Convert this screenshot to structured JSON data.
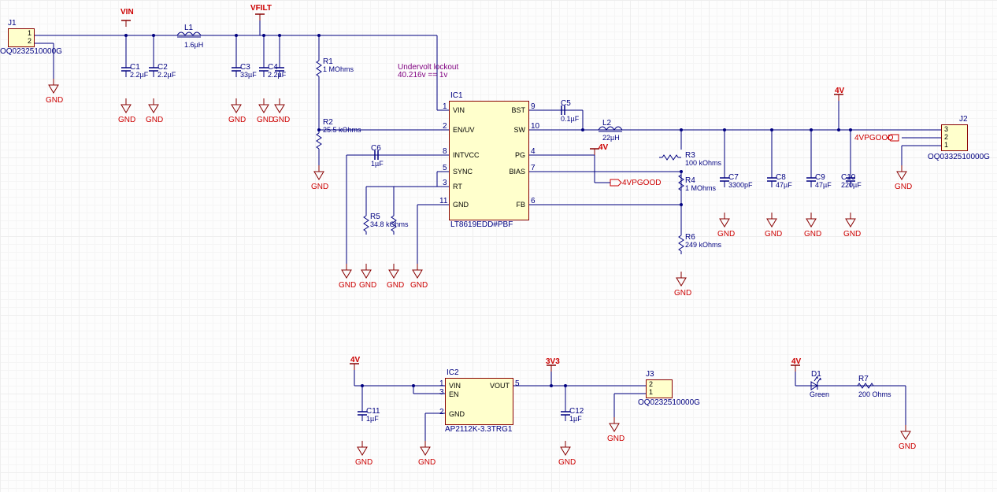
{
  "nets": {
    "vin": "VIN",
    "vfilt": "VFILT",
    "gnd": "GND",
    "4v": "4V",
    "3v3": "3V3",
    "4vpgood": "4VPGOOD"
  },
  "annotation": {
    "line1": "Undervolt lockout",
    "line2": "40.216v == 1v"
  },
  "J1": {
    "ref": "J1",
    "pn": "OQ0232510000G",
    "p1": "1",
    "p2": "2"
  },
  "J2": {
    "ref": "J2",
    "pn": "OQ0332510000G",
    "p1": "1",
    "p2": "2",
    "p3": "3"
  },
  "J3": {
    "ref": "J3",
    "pn": "OQ0232510000G",
    "p1": "1",
    "p2": "2"
  },
  "C1": {
    "ref": "C1",
    "val": "2.2µF"
  },
  "C2": {
    "ref": "C2",
    "val": "2.2µF"
  },
  "C3": {
    "ref": "C3",
    "val": "33µF"
  },
  "C4": {
    "ref": "C4",
    "val": "2.2µF"
  },
  "C5": {
    "ref": "C5",
    "val": "0.1µF"
  },
  "C6": {
    "ref": "C6",
    "val": "1µF"
  },
  "C7": {
    "ref": "C7",
    "val": "3300pF"
  },
  "C8": {
    "ref": "C8",
    "val": "47µF"
  },
  "C9": {
    "ref": "C9",
    "val": "47µF"
  },
  "C10": {
    "ref": "C10",
    "val": "220µF"
  },
  "C11": {
    "ref": "C11",
    "val": "1µF"
  },
  "C12": {
    "ref": "C12",
    "val": "1µF"
  },
  "L1": {
    "ref": "L1",
    "val": "1.6µH"
  },
  "L2": {
    "ref": "L2",
    "val": "22µH"
  },
  "R1": {
    "ref": "R1",
    "val": "1 MOhms"
  },
  "R2": {
    "ref": "R2",
    "val": "25.5 kOhms"
  },
  "R3": {
    "ref": "R3",
    "val": "100 kOhms"
  },
  "R4": {
    "ref": "R4",
    "val": "1 MOhms"
  },
  "R5": {
    "ref": "R5",
    "val": "34.8 kOhms"
  },
  "R6": {
    "ref": "R6",
    "val": "249 kOhms"
  },
  "R7": {
    "ref": "R7",
    "val": "200 Ohms"
  },
  "D1": {
    "ref": "D1",
    "val": "Green"
  },
  "IC1": {
    "ref": "IC1",
    "pn": "LT8619EDD#PBF",
    "pins": {
      "1": "VIN",
      "2": "EN/UV",
      "8": "INTVCC",
      "5": "SYNC",
      "3": "RT",
      "11": "GND",
      "9": "BST",
      "10": "SW",
      "4": "PG",
      "7": "BIAS",
      "6": "FB"
    }
  },
  "IC2": {
    "ref": "IC2",
    "pn": "AP2112K-3.3TRG1",
    "pins": {
      "1": "VIN",
      "3": "EN",
      "2": "GND",
      "5": "VOUT"
    }
  }
}
